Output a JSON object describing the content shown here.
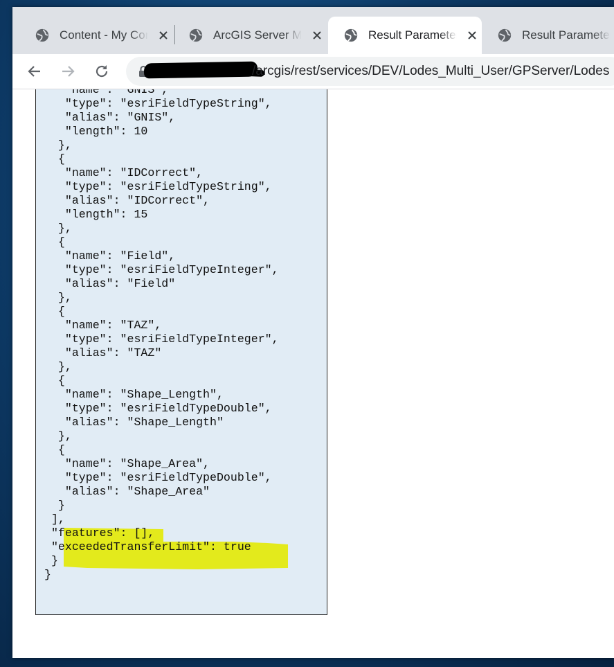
{
  "tabs": [
    {
      "label": "Content - My Content",
      "active": false
    },
    {
      "label": "ArcGIS Server Manager",
      "active": false
    },
    {
      "label": "Result Parameter",
      "active": true
    },
    {
      "label": "Result Parameter",
      "active": false
    }
  ],
  "address_bar": {
    "url": "/arcgis/rest/services/DEV/Lodes_Multi_User/GPServer/Lodes"
  },
  "json_lines": [
    "  {",
    "   \"name\": \"GNIS\",",
    "   \"type\": \"esriFieldTypeString\",",
    "   \"alias\": \"GNIS\",",
    "   \"length\": 10",
    "  },",
    "  {",
    "   \"name\": \"IDCorrect\",",
    "   \"type\": \"esriFieldTypeString\",",
    "   \"alias\": \"IDCorrect\",",
    "   \"length\": 15",
    "  },",
    "  {",
    "   \"name\": \"Field\",",
    "   \"type\": \"esriFieldTypeInteger\",",
    "   \"alias\": \"Field\"",
    "  },",
    "  {",
    "   \"name\": \"TAZ\",",
    "   \"type\": \"esriFieldTypeInteger\",",
    "   \"alias\": \"TAZ\"",
    "  },",
    "  {",
    "   \"name\": \"Shape_Length\",",
    "   \"type\": \"esriFieldTypeDouble\",",
    "   \"alias\": \"Shape_Length\"",
    "  },",
    "  {",
    "   \"name\": \"Shape_Area\",",
    "   \"type\": \"esriFieldTypeDouble\",",
    "   \"alias\": \"Shape_Area\"",
    "  }",
    " ],",
    " \"features\": [],",
    " \"exceededTransferLimit\": true",
    " }",
    "}"
  ],
  "colors": {
    "highlight": "#e3ea1c",
    "json_panel_bg": "#e1ecf5",
    "tab_strip_bg": "#dee1e6"
  }
}
